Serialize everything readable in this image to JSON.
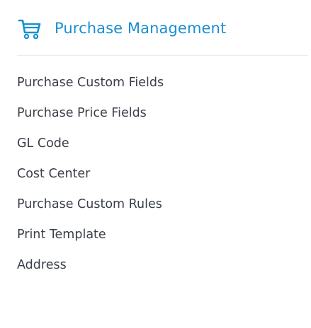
{
  "header": {
    "icon": "shopping-cart-icon",
    "title": "Purchase Management",
    "accent_color": "#1b8fd0"
  },
  "menu": {
    "items": [
      {
        "label": "Purchase Custom Fields"
      },
      {
        "label": "Purchase Price Fields"
      },
      {
        "label": "GL Code"
      },
      {
        "label": "Cost Center"
      },
      {
        "label": "Purchase Custom Rules"
      },
      {
        "label": "Print Template"
      },
      {
        "label": "Address"
      }
    ]
  }
}
